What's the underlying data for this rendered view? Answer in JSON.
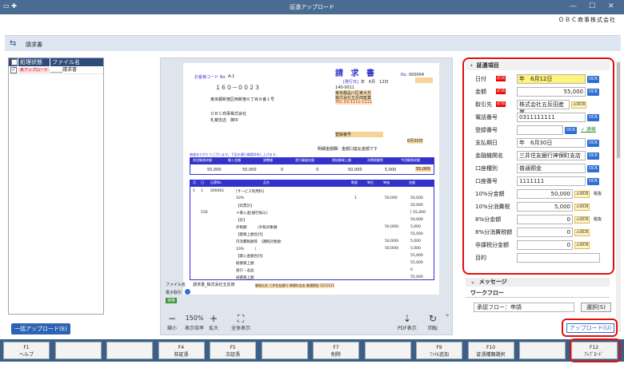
{
  "window": {
    "title": "証憑アップロード",
    "company": "ＯＢＣ商事株式会社",
    "controls": [
      "—",
      "☐",
      "✕"
    ]
  },
  "section": {
    "title": "請求書"
  },
  "file_list": {
    "headers": [
      "処理状態",
      "ファイル名"
    ],
    "rows": [
      {
        "status": "未アップロード",
        "file": "_____請求書"
      }
    ]
  },
  "bulk_upload_label": "一括アップロード(E)",
  "invoice": {
    "customer_code_label": "お客様コード No.",
    "customer_code": "A-1",
    "postal": "１６０－００２３",
    "address": "東京都新宿区西新宿６丁目８番１号",
    "recipient": "ＯＢＣ商事株式会社",
    "branch": "札幌支店　御中",
    "title": "請 求 書",
    "no_label": "No.",
    "no": "000004",
    "issue_label": "[発行日]",
    "issue_date": "年　6月　12日",
    "issuer_postal": "140-0011",
    "issuer_address": "東京都品川区東大井",
    "issuer_name": "株式会社五反田産業",
    "tel": "TEL 03-1111-1111",
    "reg_label": "登録番号",
    "deadline": "6月30日",
    "note": "明細金額欄：金額口座払金額です",
    "thanks": "毎度ありがとうございます。下記の通り御請求申し上げます。",
    "summary_headers": [
      "前回御請求額",
      "御入金額",
      "調整額",
      "差引繰越金額",
      "税抜御買上額",
      "消費税額等",
      "今回御請求額"
    ],
    "summary_values": [
      "55,000",
      "55,000",
      "0",
      "0",
      "50,000",
      "5,000",
      "55,000"
    ],
    "detail_headers": [
      "月",
      "日",
      "伝票No.",
      "品名",
      "数量",
      "単位",
      "単価",
      "金額"
    ],
    "detail_lines": [
      {
        "c1": "5",
        "c2": "1",
        "no": "000001",
        "name": "[サービス利用料]",
        "qty": "",
        "unit": "",
        "price": "",
        "amt": ""
      },
      {
        "c1": "",
        "c2": "",
        "no": "",
        "name": "10%",
        "qty": "1",
        "unit": "",
        "price": "50,000",
        "amt": "50,000"
      },
      {
        "c1": "",
        "c2": "",
        "no": "",
        "name": "【伝票計】",
        "qty": "",
        "unit": "",
        "price": "",
        "amt": "50,000"
      },
      {
        "c1": "",
        "c2": "530",
        "no": "",
        "name": "＊御入金[銀行振込]",
        "qty": "",
        "unit": "",
        "price": "",
        "amt": "[ 55,000"
      },
      {
        "c1": "",
        "c2": "",
        "no": "",
        "name": "【計】",
        "qty": "",
        "unit": "",
        "price": "",
        "amt": "50,000"
      },
      {
        "c1": "",
        "c2": "",
        "no": "",
        "name": "外税額　　　(外税対象額:",
        "qty": "",
        "unit": "",
        "price": "50,000)",
        "amt": "5,000"
      },
      {
        "c1": "",
        "c2": "",
        "no": "",
        "name": "【御買上額合計】",
        "qty": "",
        "unit": "",
        "price": "",
        "amt": "55,000"
      },
      {
        "c1": "",
        "c2": "",
        "no": "",
        "name": "内消費税額等　(課税対象額:",
        "qty": "",
        "unit": "",
        "price": "50,000)",
        "amt": "5,000"
      },
      {
        "c1": "",
        "c2": "",
        "no": "",
        "name": "10%　　　(",
        "qty": "",
        "unit": "",
        "price": "50,000)",
        "amt": "5,000"
      },
      {
        "c1": "",
        "c2": "",
        "no": "",
        "name": "【御入金額合計】",
        "qty": "",
        "unit": "",
        "price": "",
        "amt": "55,000"
      },
      {
        "c1": "",
        "c2": "",
        "no": "",
        "name": "総御買上額",
        "qty": "",
        "unit": "",
        "price": "",
        "amt": "55,000"
      },
      {
        "c1": "",
        "c2": "",
        "no": "",
        "name": "値引・返品",
        "qty": "",
        "unit": "",
        "price": "",
        "amt": "0"
      },
      {
        "c1": "",
        "c2": "",
        "no": "",
        "name": "純御買上額",
        "qty": "",
        "unit": "",
        "price": "",
        "amt": "55,000"
      }
    ],
    "bank_line": "御振込先 三井住友銀行 神保町支店 普通預金 1111111",
    "file_label": "ファイル名",
    "file_name": "請求書_株式会社五反田",
    "e_book_label": "電子取引",
    "status_label": "適格"
  },
  "viewer_toolbar": [
    {
      "icon": "−",
      "label": "縮小"
    },
    {
      "icon": "",
      "label": "表示倍率",
      "value": "150%"
    },
    {
      "icon": "+",
      "label": "拡大"
    },
    {
      "icon": "⛶",
      "label": "全体表示"
    },
    {
      "icon": "⇣",
      "label": "PDF表示"
    },
    {
      "icon": "↻",
      "label": "回転"
    }
  ],
  "panel": {
    "header": "証憑項目",
    "required": "必須",
    "ocr": "OCR",
    "fields": [
      {
        "label": "日付",
        "value": "年　6月12日",
        "required": true
      },
      {
        "label": "金額",
        "value": "55,000",
        "required": true
      },
      {
        "label": "取引先",
        "value": "株式会社五反田産業",
        "required": true,
        "warn": "OCR"
      },
      {
        "label": "電話番号",
        "value": "0311111111"
      },
      {
        "label": "登録番号",
        "value": "",
        "link": "✓ 適格"
      },
      {
        "label": "支払期日",
        "value": "年　6月30日"
      },
      {
        "label": "金融機関名",
        "value": "三井住友銀行神保町支店"
      },
      {
        "label": "口座種別",
        "value": "普通預金"
      },
      {
        "label": "口座番号",
        "value": "1111111"
      },
      {
        "label": "10%分金額",
        "value": "50,000",
        "warn": "OCR",
        "suffix": "税抜"
      },
      {
        "label": "10%分消費税",
        "value": "5,000",
        "warn": "OCR"
      },
      {
        "label": "8%分金額",
        "value": "0",
        "warn": "OCR",
        "suffix": "税抜"
      },
      {
        "label": "8%分消費税額",
        "value": "0",
        "warn": "OCR"
      },
      {
        "label": "非課税分金額",
        "value": "0",
        "warn": "OCR"
      },
      {
        "label": "目的",
        "value": ""
      }
    ]
  },
  "message_header": "メッセージ",
  "workflow": {
    "header": "ワークフロー",
    "value": "承認フロー：申請",
    "select_label": "選択(S)"
  },
  "upload_label": "アップロード(U)",
  "fkeys": [
    {
      "key": "F1",
      "label": "ヘルプ"
    },
    {
      "key": "",
      "label": ""
    },
    {
      "key": "",
      "label": ""
    },
    {
      "key": "F4",
      "label": "前証憑"
    },
    {
      "key": "F5",
      "label": "次証憑"
    },
    {
      "key": "",
      "label": ""
    },
    {
      "key": "F7",
      "label": "削除"
    },
    {
      "key": "",
      "label": ""
    },
    {
      "key": "F9",
      "label": "ﾌｧｲﾙ追加"
    },
    {
      "key": "F10",
      "label": "証憑種類選択"
    },
    {
      "key": "",
      "label": ""
    },
    {
      "key": "F12",
      "label": "ｱｯﾌﾟﾛｰﾄﾞ"
    }
  ]
}
